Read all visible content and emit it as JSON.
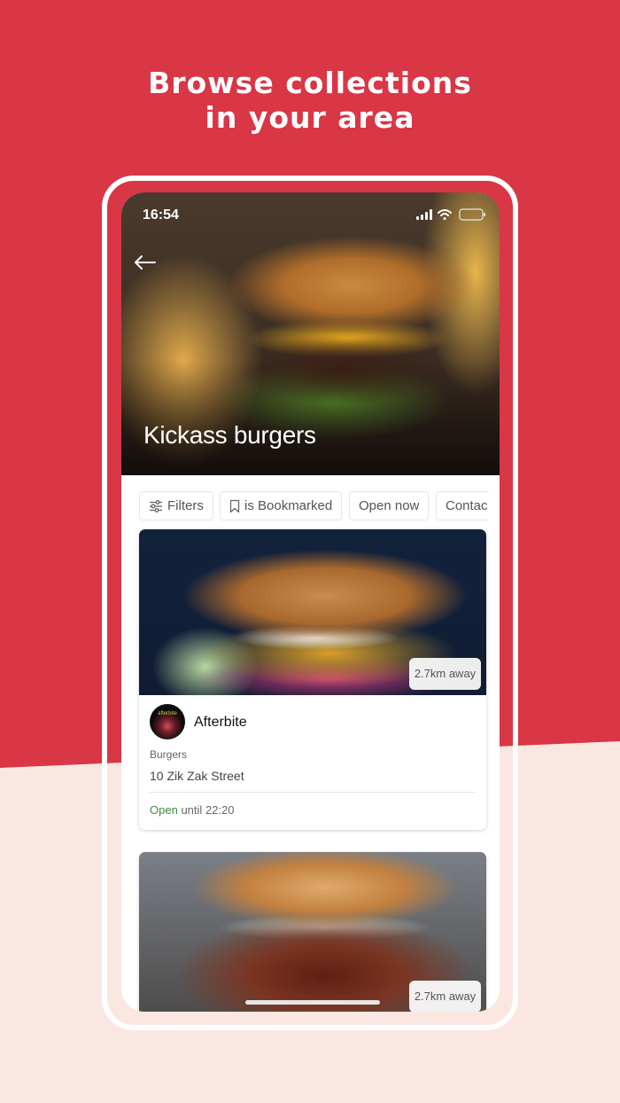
{
  "headline": {
    "line1": "Browse collections",
    "line2": "in your area"
  },
  "status_bar": {
    "time": "16:54"
  },
  "hero": {
    "title": "Kickass burgers"
  },
  "filters": [
    {
      "label": "Filters",
      "icon": "sliders-icon"
    },
    {
      "label": "is Bookmarked",
      "icon": "bookmark-icon"
    },
    {
      "label": "Open now"
    },
    {
      "label": "Contac"
    }
  ],
  "restaurants": [
    {
      "distance": "2.7km away",
      "logo_text": "afterbite",
      "name": "Afterbite",
      "cuisine": "Burgers",
      "address": "10 Zik Zak Street",
      "status": "Open",
      "hours": "until 22:20"
    },
    {
      "distance": "2.7km away"
    }
  ],
  "colors": {
    "brand_red": "#d93646",
    "background_light": "#fbe7e1",
    "open_green": "#3d8a3d"
  }
}
